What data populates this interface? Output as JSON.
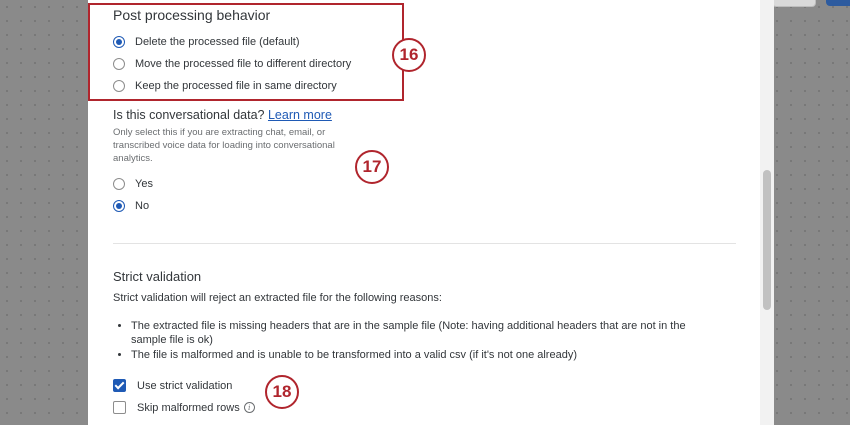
{
  "post_processing": {
    "title": "Post processing behavior",
    "options": [
      {
        "label": "Delete the processed file (default)",
        "selected": true
      },
      {
        "label": "Move the processed file to different directory",
        "selected": false
      },
      {
        "label": "Keep the processed file in same directory",
        "selected": false
      }
    ],
    "step_badge": "16"
  },
  "conversational": {
    "title": "Is this conversational data?",
    "link": "Learn more",
    "help": "Only select this if you are extracting chat, email, or transcribed voice data for loading into conversational analytics.",
    "options": [
      {
        "label": "Yes",
        "selected": false
      },
      {
        "label": "No",
        "selected": true
      }
    ],
    "step_badge": "17"
  },
  "strict_validation": {
    "title": "Strict validation",
    "description": "Strict validation will reject an extracted file for the following reasons:",
    "reasons": [
      "The extracted file is missing headers that are in the sample file (Note: having additional headers that are not in the sample file is ok)",
      "The file is malformed and is unable to be transformed into a valid csv (if it's not one already)"
    ],
    "checkboxes": [
      {
        "label": "Use strict validation",
        "checked": true
      },
      {
        "label": "Skip malformed rows",
        "checked": false
      }
    ],
    "info_icon": "info-icon",
    "step_badge": "18"
  },
  "colors": {
    "accent": "#1f5ab5",
    "highlight": "#b0252d"
  }
}
